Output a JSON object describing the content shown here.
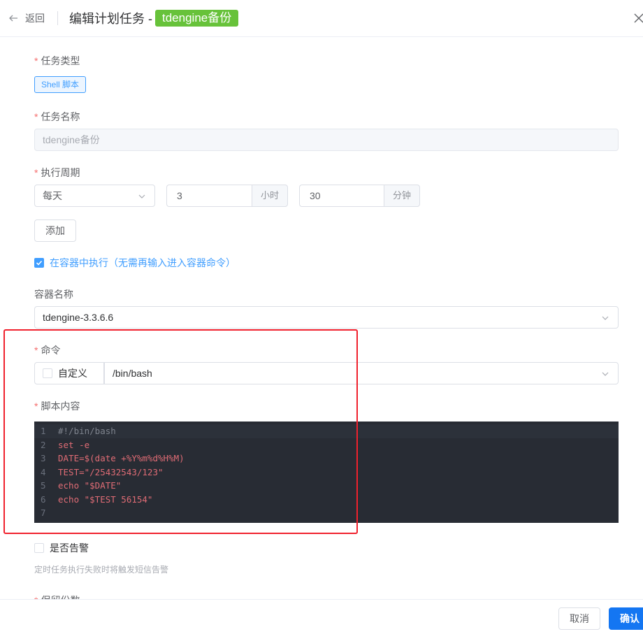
{
  "header": {
    "back_label": "返回",
    "title": "编辑计划任务 -",
    "task_tag": "tdengine备份"
  },
  "form": {
    "task_type": {
      "label": "任务类型",
      "value": "Shell 脚本"
    },
    "task_name": {
      "label": "任务名称",
      "value": "tdengine备份"
    },
    "schedule": {
      "label": "执行周期",
      "period": "每天",
      "hour": "3",
      "hour_unit": "小时",
      "minute": "30",
      "minute_unit": "分钟",
      "add_label": "添加"
    },
    "in_container": {
      "label": "在容器中执行（无需再输入进入容器命令）",
      "checked": true
    },
    "container_name": {
      "label": "容器名称",
      "value": "tdengine-3.3.6.6"
    },
    "command": {
      "label": "命令",
      "custom_label": "自定义",
      "custom_checked": false,
      "value": "/bin/bash"
    },
    "script": {
      "label": "脚本内容",
      "lines": [
        {
          "no": "1",
          "text": "#!/bin/bash",
          "color": "#7f848e"
        },
        {
          "no": "2",
          "text": "set -e",
          "color": "#e06c75"
        },
        {
          "no": "3",
          "text": "DATE=$(date +%Y%m%d%H%M)",
          "color": "#e06c75"
        },
        {
          "no": "4",
          "text": "TEST=\"/25432543/123\"",
          "color": "#e06c75"
        },
        {
          "no": "5",
          "text": "echo \"$DATE\"",
          "color": "#e06c75"
        },
        {
          "no": "6",
          "text": "echo \"$TEST 56154\"",
          "color": "#e06c75"
        },
        {
          "no": "7",
          "text": "",
          "color": "#abb2bf"
        }
      ]
    },
    "alert": {
      "label": "是否告警",
      "checked": false,
      "hint": "定时任务执行失败时将触发短信告警"
    },
    "retention": {
      "label": "保留份数"
    }
  },
  "footer": {
    "cancel_label": "取消",
    "confirm_label": "确认"
  },
  "colors": {
    "primary": "#409eff",
    "success": "#67c23a",
    "danger": "#f56c6c",
    "editor_bg": "#282c34"
  }
}
